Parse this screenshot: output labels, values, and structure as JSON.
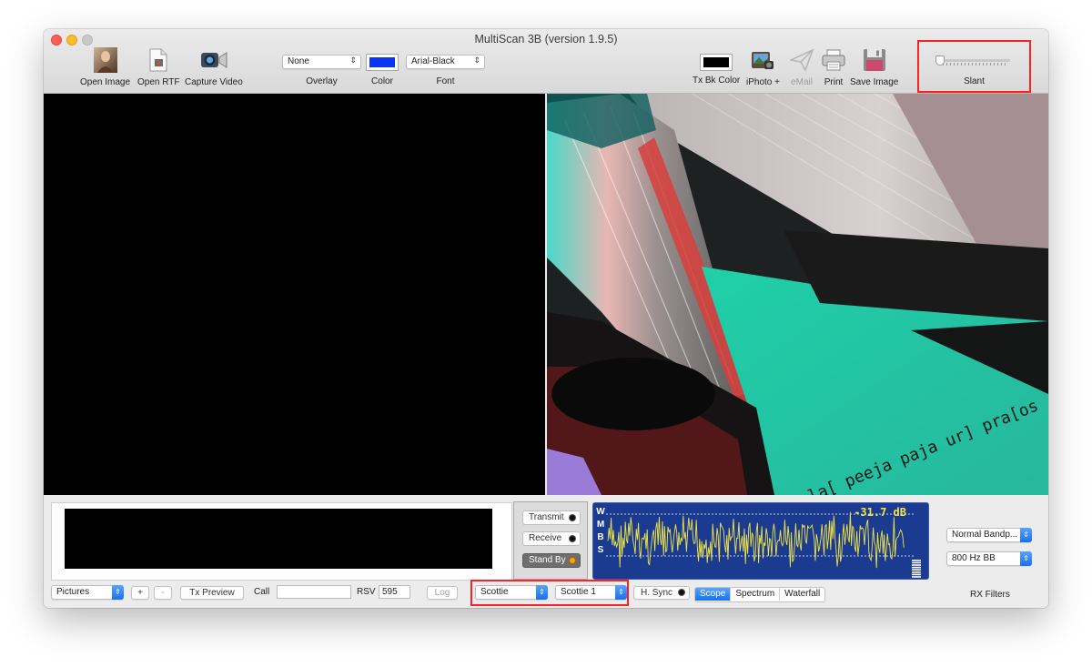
{
  "window": {
    "title": "MultiScan 3B (version 1.9.5)"
  },
  "toolbar": {
    "open_image": "Open Image",
    "open_rtf": "Open RTF",
    "capture_video": "Capture Video",
    "overlay": {
      "value": "None",
      "label": "Overlay"
    },
    "color": {
      "label": "Color",
      "value": "#0b35f2"
    },
    "font": {
      "value": "Arial-Black",
      "label": "Font"
    },
    "tx_bk_color": {
      "label": "Tx Bk Color",
      "value": "#000000"
    },
    "iphoto": "iPhoto +",
    "email": "eMail",
    "print": "Print",
    "save_image": "Save Image",
    "slant": {
      "label": "Slant",
      "level": 0.0
    }
  },
  "images": {
    "rx_caption_text": "pla[ peeja paja ur] pra[os"
  },
  "controls": {
    "transmit": "Transmit",
    "receive": "Receive",
    "stand_by": "Stand By",
    "active_mode": "Stand By"
  },
  "scope": {
    "letters": [
      "W",
      "M",
      "B",
      "S"
    ],
    "level": "-31.7 dB"
  },
  "filters": {
    "bandpass": "Normal Bandp...",
    "bb": "800 Hz BB",
    "label": "RX Filters"
  },
  "bottom_bar": {
    "folder": "Pictures",
    "plus": "+",
    "minus": "-",
    "tx_preview": "Tx Preview",
    "call_label": "Call",
    "call_value": "",
    "rsv_label": "RSV",
    "rsv_value": "595",
    "log": "Log",
    "mode_family": "Scottie",
    "mode": "Scottie 1",
    "hsync": "H. Sync",
    "views": [
      "Scope",
      "Spectrum",
      "Waterfall"
    ],
    "active_view": "Scope"
  },
  "colors": {
    "highlight_box": "#ff2020",
    "scope_bg": "#1a3b8f",
    "scope_trace": "#f2e447",
    "accent_blue": "#1a6ff2"
  }
}
